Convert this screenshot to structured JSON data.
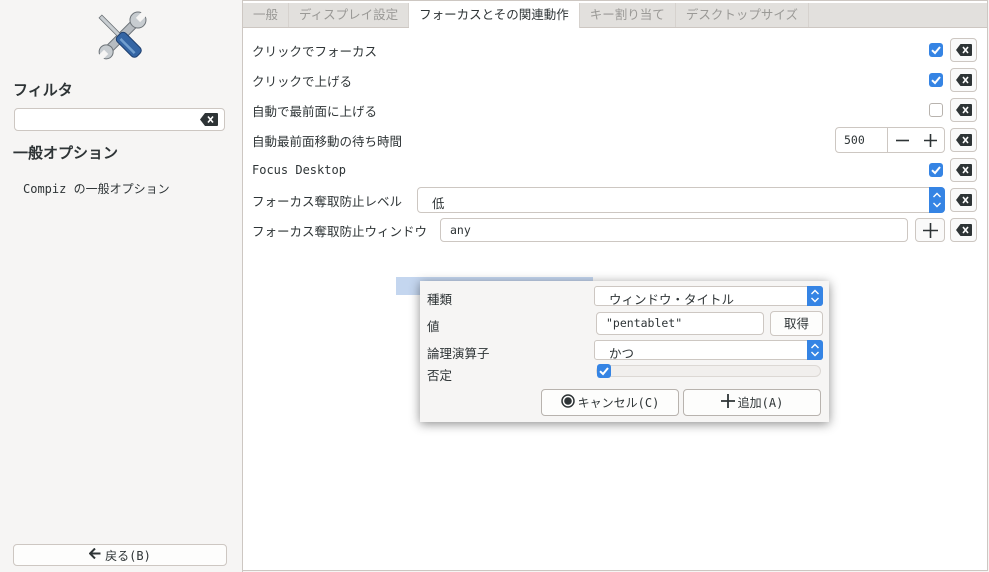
{
  "sidebar": {
    "filter_heading": "フィルタ",
    "filter_placeholder": "",
    "options_heading": "一般オプション",
    "items": [
      {
        "label": "Compiz の一般オプション"
      }
    ],
    "back_button": "戻る(B)"
  },
  "tabs": [
    {
      "label": "一般",
      "active": false
    },
    {
      "label": "ディスプレイ設定",
      "active": false
    },
    {
      "label": "フォーカスとその関連動作",
      "active": true
    },
    {
      "label": "キー割り当て",
      "active": false
    },
    {
      "label": "デスクトップサイズ",
      "active": false
    }
  ],
  "settings": {
    "click_to_focus": {
      "label": "クリックでフォーカス",
      "checked": true
    },
    "raise_on_click": {
      "label": "クリックで上げる",
      "checked": true
    },
    "autoraise": {
      "label": "自動で最前面に上げる",
      "checked": false
    },
    "autoraise_delay": {
      "label": "自動最前面移動の待ち時間",
      "value": "500"
    },
    "focus_desktop": {
      "label": "Focus Desktop",
      "checked": true
    },
    "focus_prevention_level": {
      "label": "フォーカス奪取防止レベル",
      "value": "低"
    },
    "focus_prevention_windows": {
      "label": "フォーカス奪取防止ウィンドウ",
      "value": "any"
    }
  },
  "dialog": {
    "type_label": "種類",
    "type_value": "ウィンドウ・タイトル",
    "value_label": "値",
    "value_text": "\"pentablet\"",
    "grab_button": "取得",
    "operator_label": "論理演算子",
    "operator_value": "かつ",
    "negate_label": "否定",
    "negate_checked": true,
    "cancel_button": "キャンセル(C)",
    "add_button": "追加(A)"
  },
  "colors": {
    "accent": "#3584e4",
    "selection": "#c4d6ef"
  },
  "icons": [
    "tools-icon",
    "clear-icon",
    "checkmark-icon",
    "minus-icon",
    "plus-icon",
    "arrow-left-icon",
    "record-icon",
    "chevron-updown-icon"
  ]
}
